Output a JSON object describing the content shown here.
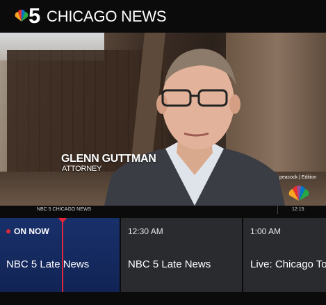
{
  "header": {
    "logo_icon": "nbc-peacock-icon",
    "channel_number": "5",
    "station_name": "CHICAGO NEWS"
  },
  "video": {
    "lower_third_name": "GLENN GUTTMAN",
    "lower_third_title": "ATTORNEY",
    "watermark_text": "peacock | Edition",
    "watermark_icon": "nbc-peacock-icon"
  },
  "info_strip": {
    "channel_label": "NBC 5 CHICAGO NEWS",
    "current_time": "12:15"
  },
  "guide": {
    "on_now_label": "ON NOW",
    "programs": [
      {
        "time": "",
        "title": "NBC 5 Late News"
      },
      {
        "time": "12:30 AM",
        "title": "NBC 5 Late News"
      },
      {
        "time": "1:00 AM",
        "title": "Live: Chicago To"
      }
    ]
  },
  "colors": {
    "accent_red": "#e1283a",
    "on_now_blue": "#18306a",
    "cell_gray": "#2a2b2f",
    "background": "#0b0b0c"
  }
}
